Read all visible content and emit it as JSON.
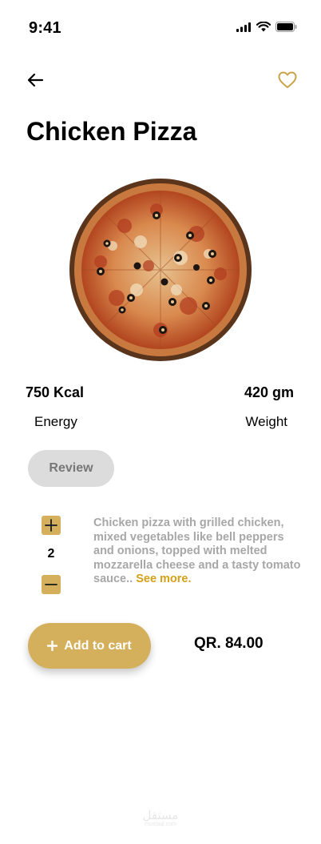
{
  "status_bar": {
    "time": "9:41"
  },
  "product": {
    "name": "Chicken Pizza",
    "energy_value": "750 Kcal",
    "energy_label": "Energy",
    "weight_value": "420 gm",
    "weight_label": "Weight",
    "description": "Chicken pizza with grilled chicken, mixed vegetables like bell peppers and onions, topped with melted mozzarella cheese and a tasty tomato sauce.. ",
    "see_more": "See more.",
    "price": "QR. 84.00"
  },
  "buttons": {
    "review": "Review",
    "add_to_cart": "Add to cart"
  },
  "quantity": "2",
  "watermark": {
    "arabic": "مستقل",
    "latin": "mostaql.com"
  },
  "colors": {
    "accent": "#d4af5c",
    "see_more": "#d4a017",
    "description": "#a7a7a7",
    "review_bg": "#dcdcdc"
  },
  "icons": [
    "back-arrow-icon",
    "heart-icon",
    "plus-icon",
    "minus-icon",
    "signal-icon",
    "wifi-icon",
    "battery-icon"
  ]
}
